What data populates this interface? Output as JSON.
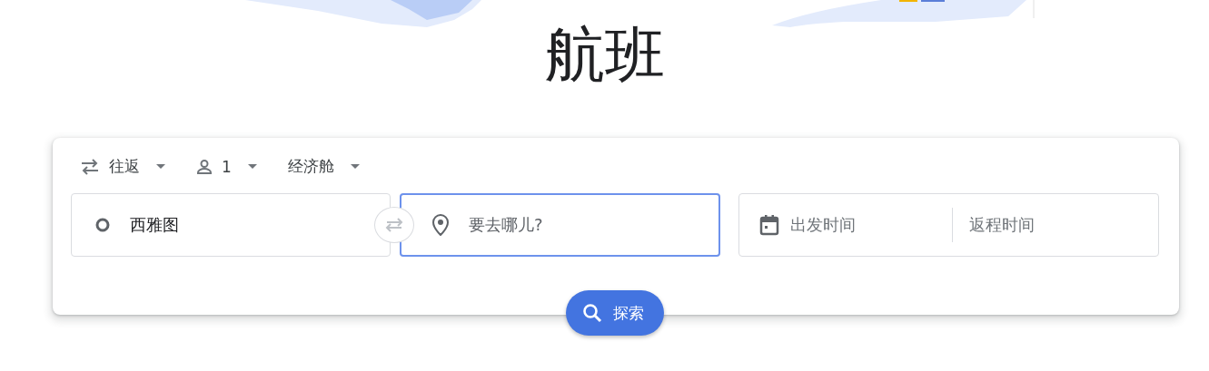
{
  "header_title": "航班",
  "trip_options": [
    {
      "kind": "trip_type",
      "label": "往返"
    },
    {
      "kind": "passengers",
      "label": "1"
    },
    {
      "kind": "cabin",
      "label": "经济舱"
    }
  ],
  "origin": {
    "value": "西雅图"
  },
  "destination": {
    "placeholder": "要去哪儿?",
    "focused": true
  },
  "dates": {
    "departure_placeholder": "出发时间",
    "return_placeholder": "返程时间"
  },
  "search_button": {
    "label": "探索"
  }
}
